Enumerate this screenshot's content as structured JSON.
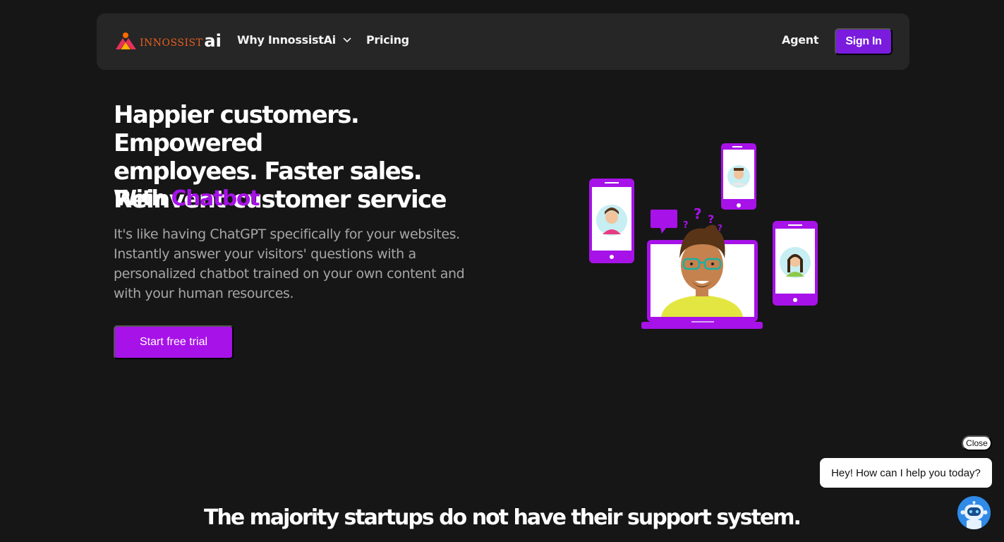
{
  "nav": {
    "logo_word": "INNOSSIST",
    "logo_ai": "ai",
    "why_label": "Why InnossistAi",
    "pricing_label": "Pricing",
    "agent_label": "Agent",
    "signin_label": "Sign In"
  },
  "hero": {
    "title_line1": "Happier customers. Empowered",
    "title_line2": "employees. Faster sales.",
    "title_line3": "Reinvent customer service",
    "with_label": "With",
    "chatbot_label": "Chatbot",
    "subtitle": "It's like having ChatGPT specifically for your websites. Instantly answer your visitors' questions with a personalized chatbot trained on your own content and with your human resources.",
    "cta_label": "Start free trial"
  },
  "section": {
    "title": "The majority startups do not have their support system."
  },
  "chat_widget": {
    "close_label": "Close",
    "greeting": "Hey! How can I help you today?"
  },
  "colors": {
    "accent_purple": "#a712e8",
    "signin_purple": "#7a1bde",
    "background": "#161616",
    "navbar": "#262626"
  }
}
